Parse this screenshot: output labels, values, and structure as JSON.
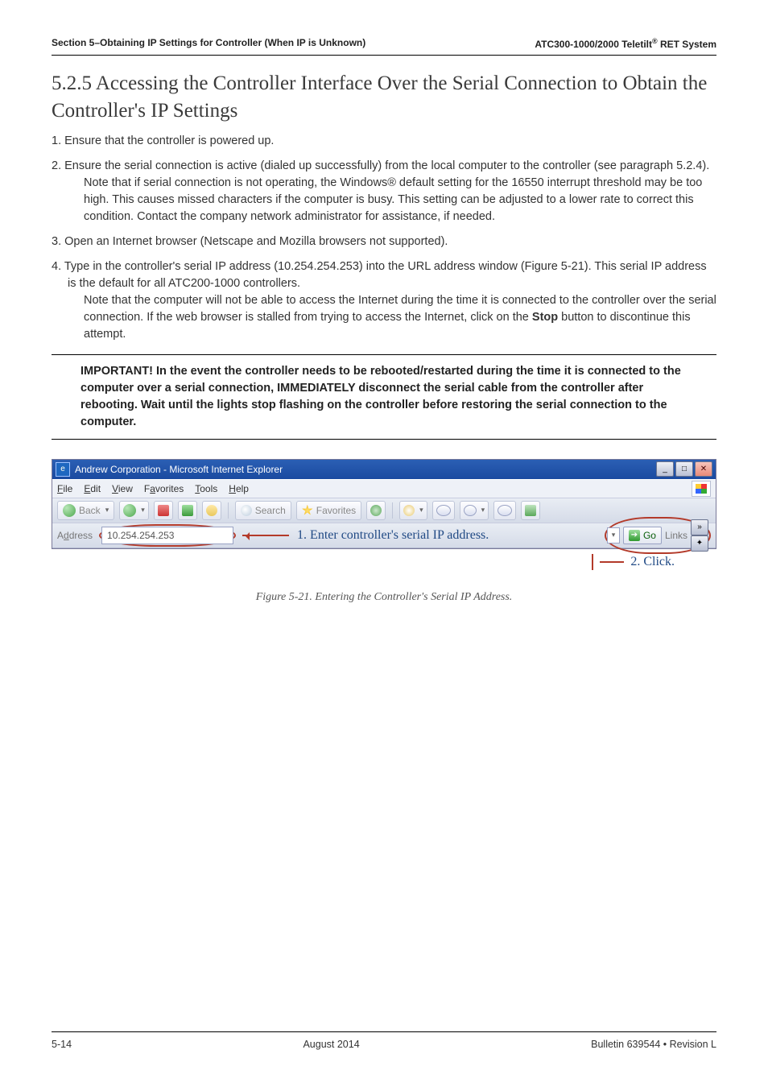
{
  "header": {
    "section_left": "Section 5–Obtaining IP Settings for Controller (When IP is Unknown)",
    "section_right_pre": "ATC300-1000/2000 Teletilt",
    "section_right_sup": "®",
    "section_right_post": " RET System"
  },
  "title": "5.2.5 Accessing the Controller Interface Over the Serial Connection to Obtain the Controller's IP Settings",
  "steps": {
    "s1": "1. Ensure that the controller is powered up.",
    "s2a": "2. Ensure the serial connection is active (dialed up successfully) from the local computer to the controller (see paragraph 5.2.4).",
    "s2b": "Note that if serial connection is not operating, the Windows® default setting for the 16550 interrupt threshold may be too high. This causes missed characters if the computer is busy. This setting can be adjusted to a lower rate to correct this condition. Contact the company network administrator for assistance, if needed.",
    "s3": "3. Open an Internet browser (Netscape and Mozilla browsers not supported).",
    "s4a": "4. Type in the controller's serial IP address (10.254.254.253) into the URL address window (Figure 5-21). This serial IP address is the default for all ATC200-1000 controllers.",
    "s4b_pre": "Note that the computer will not be able to access the Internet during the time it is connected to the controller over the serial connection. If the web browser is stalled from trying to access the Internet, click on the ",
    "s4b_bold": "Stop",
    "s4b_post": " button to discontinue this attempt."
  },
  "callout": "IMPORTANT! In the event the controller needs to be rebooted/restarted during the time it is connected to the computer over a serial connection, IMMEDIATELY disconnect the serial cable from the controller after rebooting. Wait until the lights stop flashing on the controller before restoring the serial connection to the computer.",
  "ie": {
    "title": "Andrew Corporation - Microsoft Internet Explorer",
    "menu": {
      "file": "File",
      "edit": "Edit",
      "view": "View",
      "fav": "Favorites",
      "tools": "Tools",
      "help": "Help"
    },
    "tb": {
      "back": "Back",
      "search": "Search",
      "favorites": "Favorites"
    },
    "addr_label": "Address",
    "addr_value": "10.254.254.253",
    "go": "Go",
    "links": "Links"
  },
  "annot": {
    "a1": "1. Enter controller's serial IP address.",
    "a2": "2. Click."
  },
  "figcap": "Figure 5-21. Entering the Controller's Serial IP Address.",
  "footer": {
    "left": "5-14",
    "center": "August 2014",
    "right": "Bulletin 639544  •  Revision L"
  }
}
